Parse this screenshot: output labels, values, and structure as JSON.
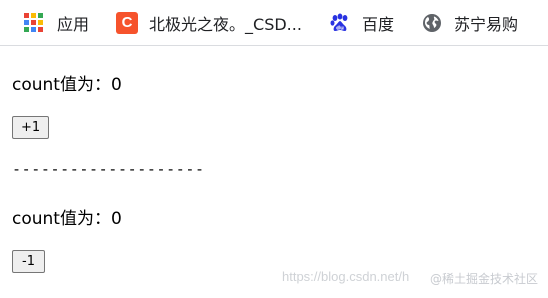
{
  "bookmarks": [
    {
      "icon": "apps-grid-icon",
      "label": "应用"
    },
    {
      "icon": "csdn-logo-icon",
      "icon_text": "C",
      "label": "北极光之夜。_CSD..."
    },
    {
      "icon": "baidu-paw-icon",
      "label": "百度"
    },
    {
      "icon": "globe-icon",
      "label": "苏宁易购"
    }
  ],
  "colors": {
    "apps_grid": [
      "#ea4335",
      "#fbbc05",
      "#34a853",
      "#4285f4",
      "#ea4335",
      "#fbbc05",
      "#34a853",
      "#4285f4",
      "#ea4335"
    ],
    "csdn": "#f6532c",
    "baidu": "#2932e1",
    "globe": "#5f6368"
  },
  "app": {
    "count_line_1": "count值为：0",
    "increment_button": "+1",
    "separator": "--------------------",
    "count_line_2": "count值为：0",
    "decrement_button": "-1"
  },
  "watermark": {
    "url": "https://blog.csdn.net/h",
    "brand": "@稀土掘金技术社区"
  }
}
